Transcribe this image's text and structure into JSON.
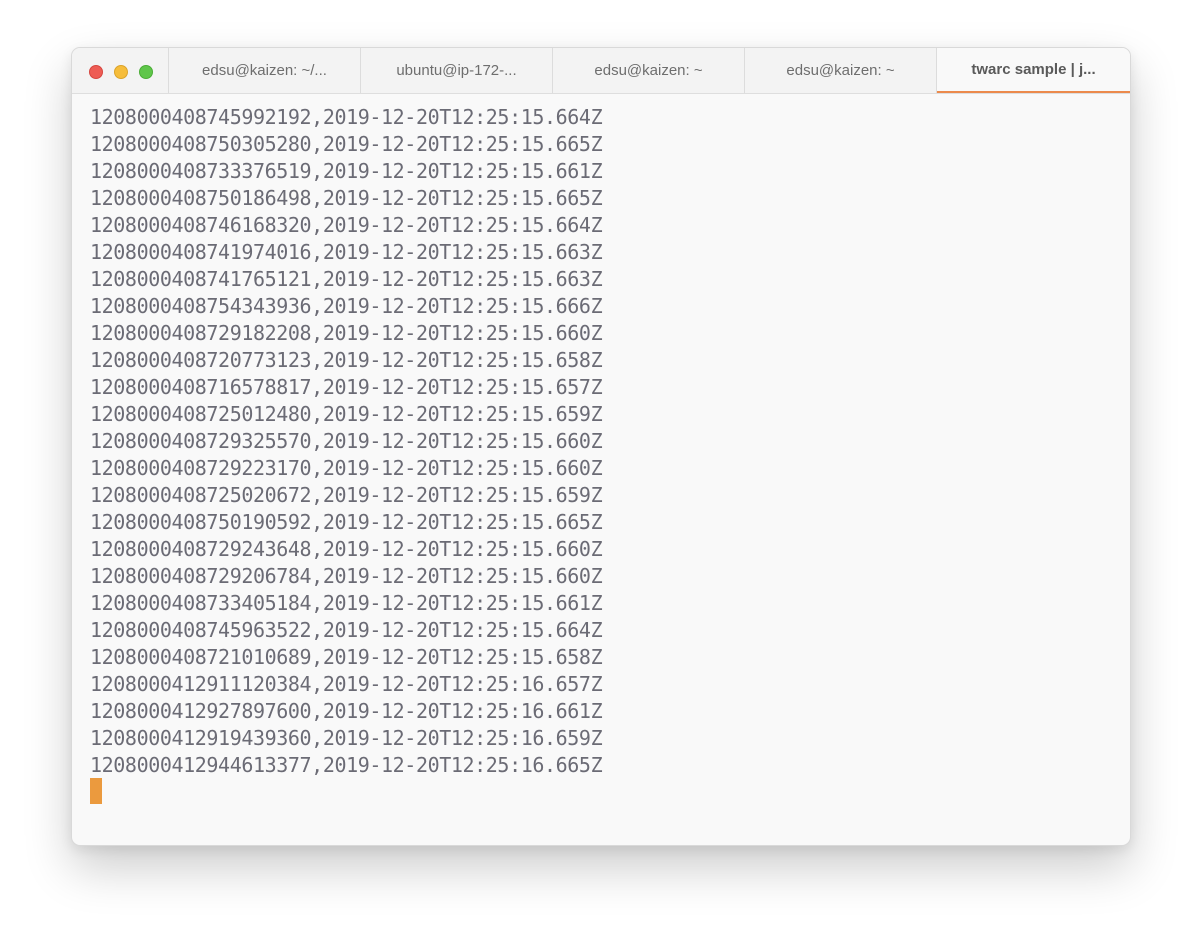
{
  "tabs": [
    {
      "label": "edsu@kaizen: ~/...",
      "active": false
    },
    {
      "label": "ubuntu@ip-172-...",
      "active": false
    },
    {
      "label": "edsu@kaizen: ~",
      "active": false
    },
    {
      "label": "edsu@kaizen: ~",
      "active": false
    },
    {
      "label": "twarc sample | j...",
      "active": true
    }
  ],
  "terminal": {
    "lines": [
      "1208000408745992192,2019-12-20T12:25:15.664Z",
      "1208000408750305280,2019-12-20T12:25:15.665Z",
      "1208000408733376519,2019-12-20T12:25:15.661Z",
      "1208000408750186498,2019-12-20T12:25:15.665Z",
      "1208000408746168320,2019-12-20T12:25:15.664Z",
      "1208000408741974016,2019-12-20T12:25:15.663Z",
      "1208000408741765121,2019-12-20T12:25:15.663Z",
      "1208000408754343936,2019-12-20T12:25:15.666Z",
      "1208000408729182208,2019-12-20T12:25:15.660Z",
      "1208000408720773123,2019-12-20T12:25:15.658Z",
      "1208000408716578817,2019-12-20T12:25:15.657Z",
      "1208000408725012480,2019-12-20T12:25:15.659Z",
      "1208000408729325570,2019-12-20T12:25:15.660Z",
      "1208000408729223170,2019-12-20T12:25:15.660Z",
      "1208000408725020672,2019-12-20T12:25:15.659Z",
      "1208000408750190592,2019-12-20T12:25:15.665Z",
      "1208000408729243648,2019-12-20T12:25:15.660Z",
      "1208000408729206784,2019-12-20T12:25:15.660Z",
      "1208000408733405184,2019-12-20T12:25:15.661Z",
      "1208000408745963522,2019-12-20T12:25:15.664Z",
      "1208000408721010689,2019-12-20T12:25:15.658Z",
      "1208000412911120384,2019-12-20T12:25:16.657Z",
      "1208000412927897600,2019-12-20T12:25:16.661Z",
      "1208000412919439360,2019-12-20T12:25:16.659Z",
      "1208000412944613377,2019-12-20T12:25:16.665Z"
    ]
  },
  "colors": {
    "close": "#ee5c54",
    "minimize": "#f6bd3b",
    "maximize": "#5fc64a",
    "active_tab_accent": "#ec8a4c",
    "cursor": "#eb9a3e",
    "text": "#6b6b75"
  }
}
